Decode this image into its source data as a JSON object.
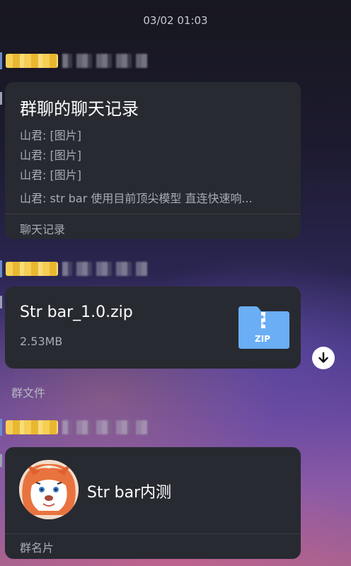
{
  "timestamp": "03/02 01:03",
  "chat_history_card": {
    "title": "群聊的聊天记录",
    "lines": [
      "山君: [图片]",
      "山君: [图片]",
      "山君: [图片]",
      "山君: str bar 使用目前顶尖模型 直连快速响..."
    ],
    "footer": "聊天记录"
  },
  "file_card": {
    "file_name": "Str bar_1.0.zip",
    "file_size": "2.53MB",
    "icon": "zip-folder-icon",
    "icon_text": "ZIP",
    "icon_color": "#6aaef5",
    "caption": "群文件"
  },
  "contact_card": {
    "name": "Str bar内测",
    "footer": "群名片"
  },
  "colors": {
    "card_bg": "#282a31",
    "secondary_text": "#a9abb3",
    "sender_tag": "#f5cf55"
  }
}
